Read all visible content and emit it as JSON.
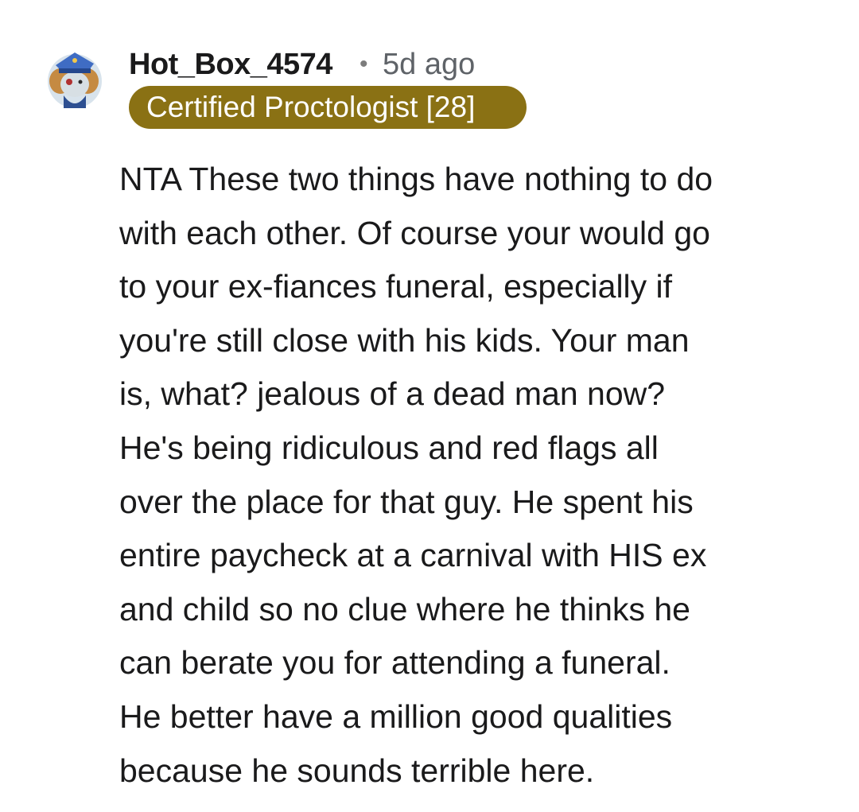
{
  "comment": {
    "username": "Hot_Box_4574",
    "separator": "•",
    "timestamp": "5d ago",
    "flair": "Certified Proctologist [28]",
    "body_lines": [
      "NTA These two things have nothing to do",
      "with each other. Of course your would go",
      "to your ex-fiances funeral, especially if",
      "you're still close with his kids. Your man",
      "is, what? jealous of a dead man now?",
      "He's being ridiculous and red flags all",
      "over the place for that guy. He spent his",
      "entire paycheck at a carnival with HIS ex",
      "and child so no clue where he thinks he",
      "can berate you for attending a funeral.",
      "He better have a million good qualities",
      "because he sounds terrible here."
    ]
  },
  "colors": {
    "flair_background": "#8a7114",
    "flair_text": "#ffffff",
    "text_primary": "#1a1a1b",
    "text_secondary": "#5f6368"
  },
  "icons": {
    "avatar": "snoo-avatar-icon"
  }
}
